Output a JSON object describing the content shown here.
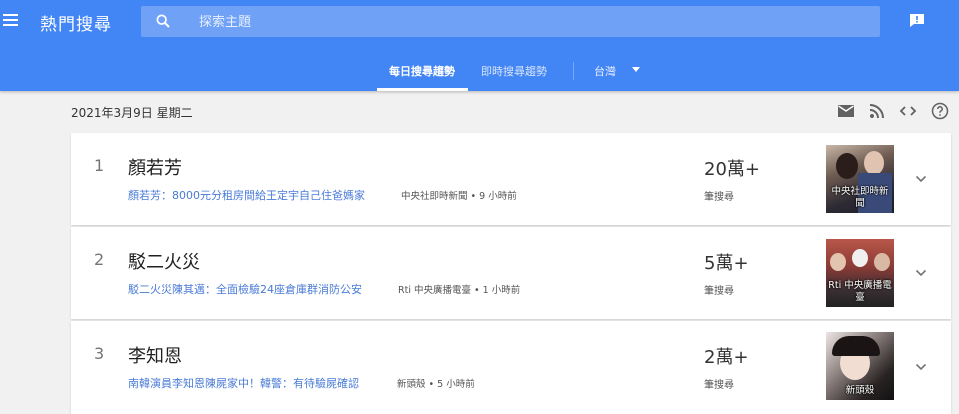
{
  "app": {
    "title": "熱門搜尋"
  },
  "search": {
    "placeholder": "探索主題"
  },
  "tabs": [
    {
      "label": "每日搜尋趨勢",
      "active": true
    },
    {
      "label": "即時搜尋趨勢",
      "active": false
    }
  ],
  "region": {
    "label": "台灣"
  },
  "date": "2021年3月9日 星期二",
  "toolbar": {
    "icons": [
      "email-icon",
      "rss-icon",
      "embed-code-icon",
      "help-icon"
    ]
  },
  "trends": [
    {
      "rank": "1",
      "title": "顏若芳",
      "headline": "顏若芳：8000元分租房間給王定宇自己住爸媽家",
      "source": "中央社即時新聞 • 9 小時前",
      "count": "20萬+",
      "count_label": "筆搜尋",
      "image_caption": "中央社即時新\n聞"
    },
    {
      "rank": "2",
      "title": "駁二火災",
      "headline": "駁二火災陳其邁：全面檢驗24座倉庫群消防公安",
      "source": "Rti 中央廣播電臺 • 1 小時前",
      "count": "5萬+",
      "count_label": "筆搜尋",
      "image_caption": "Rti 中央廣播電\n臺"
    },
    {
      "rank": "3",
      "title": "李知恩",
      "headline": "南韓演員李知恩陳屍家中！韓警：有待驗屍確認",
      "source": "新頭殼 • 5 小時前",
      "count": "2萬+",
      "count_label": "筆搜尋",
      "image_caption": "新頭殼"
    }
  ],
  "colors": {
    "header": "#4285f4",
    "search_bg": "#6fa1f7",
    "link": "#4a7bd6"
  }
}
